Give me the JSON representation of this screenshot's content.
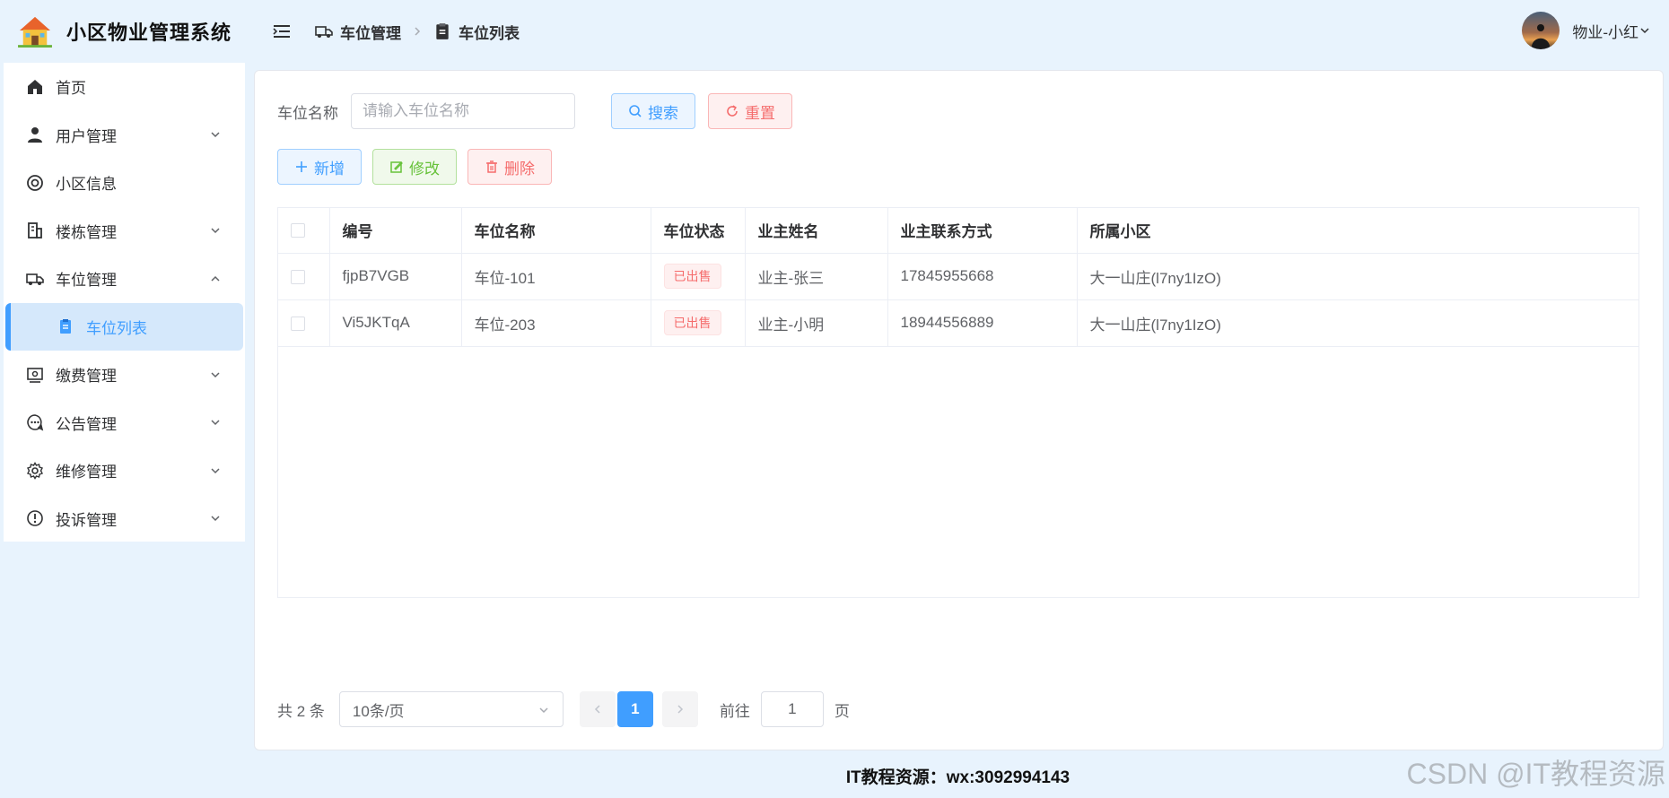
{
  "app": {
    "title": "小区物业管理系统"
  },
  "sidebar": {
    "items": [
      {
        "label": "首页",
        "icon": "home-icon",
        "expandable": false
      },
      {
        "label": "用户管理",
        "icon": "user-icon",
        "expandable": true
      },
      {
        "label": "小区信息",
        "icon": "help-buoy-icon",
        "expandable": false
      },
      {
        "label": "楼栋管理",
        "icon": "building-icon",
        "expandable": true
      },
      {
        "label": "车位管理",
        "icon": "truck-icon",
        "expandable": true,
        "expanded": true
      },
      {
        "label": "车位列表",
        "icon": "clipboard-icon",
        "active": true
      },
      {
        "label": "缴费管理",
        "icon": "wallet-icon",
        "expandable": true
      },
      {
        "label": "公告管理",
        "icon": "chat-dots-icon",
        "expandable": true
      },
      {
        "label": "维修管理",
        "icon": "gear-icon",
        "expandable": true
      },
      {
        "label": "投诉管理",
        "icon": "warning-circle-icon",
        "expandable": true
      }
    ]
  },
  "header": {
    "breadcrumb": [
      {
        "label": "车位管理",
        "icon": "truck-icon"
      },
      {
        "label": "车位列表",
        "icon": "clipboard-icon"
      }
    ],
    "user_name": "物业-小红"
  },
  "search": {
    "label": "车位名称",
    "placeholder": "请输入车位名称",
    "value": "",
    "search_label": "搜索",
    "reset_label": "重置"
  },
  "actions": {
    "add_label": "新增",
    "edit_label": "修改",
    "delete_label": "删除"
  },
  "table": {
    "columns": [
      "编号",
      "车位名称",
      "车位状态",
      "业主姓名",
      "业主联系方式",
      "所属小区"
    ],
    "rows": [
      {
        "id": "fjpB7VGB",
        "name": "车位-101",
        "status": "已出售",
        "owner": "业主-张三",
        "phone": "17845955668",
        "community": "大一山庄(l7ny1IzO)"
      },
      {
        "id": "Vi5JKTqA",
        "name": "车位-203",
        "status": "已出售",
        "owner": "业主-小明",
        "phone": "18944556889",
        "community": "大一山庄(l7ny1IzO)"
      }
    ]
  },
  "pagination": {
    "total_text": "共 2 条",
    "page_size": "10条/页",
    "current_page": "1",
    "goto_label": "前往",
    "goto_value": "1",
    "page_suffix": "页"
  },
  "footer": {
    "text": "IT教程资源：wx:3092994143"
  },
  "watermark": "CSDN @IT教程资源",
  "colors": {
    "primary": "#409eff",
    "danger": "#f56c6c",
    "success": "#67c23a",
    "page_bg": "#e8f3fd"
  }
}
